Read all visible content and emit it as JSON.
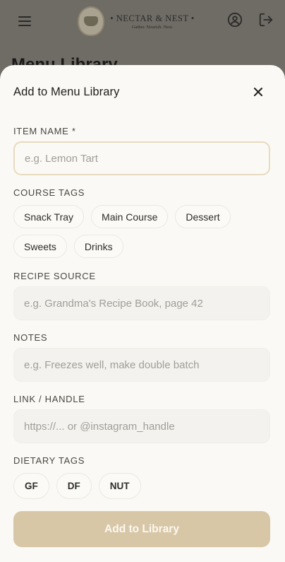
{
  "app": {
    "brand_name": "• NECTAR & NEST •",
    "brand_tagline": "Gather. Nourish. Nest.",
    "background_title": "Menu Library"
  },
  "modal": {
    "title": "Add to Menu Library",
    "item_name_label": "ITEM NAME *",
    "item_name_value": "",
    "item_name_placeholder": "e.g. Lemon Tart",
    "course_tags_label": "COURSE TAGS",
    "course_tags": [
      "Snack Tray",
      "Main Course",
      "Dessert",
      "Sweets",
      "Drinks"
    ],
    "recipe_source_label": "RECIPE SOURCE",
    "recipe_source_value": "",
    "recipe_source_placeholder": "e.g. Grandma's Recipe Book, page 42",
    "notes_label": "NOTES",
    "notes_value": "",
    "notes_placeholder": "e.g. Freezes well, make double batch",
    "link_label": "LINK / HANDLE",
    "link_value": "",
    "link_placeholder": "https://... or @instagram_handle",
    "dietary_tags_label": "DIETARY TAGS",
    "dietary_tags": [
      "GF",
      "DF",
      "NUT"
    ],
    "submit_label": "Add to Library"
  },
  "colors": {
    "overlay": "#6f6c66",
    "sheet": "#faf9f5",
    "accent_border": "#e7dbbf",
    "submit": "#d8c7a6"
  },
  "icons": {
    "menu": "hamburger-menu-icon",
    "account": "user-circle-icon",
    "logout": "logout-icon",
    "close": "close-icon"
  }
}
